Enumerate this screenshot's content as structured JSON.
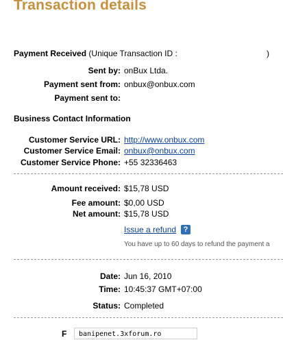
{
  "title": "Transaction details",
  "payment": {
    "label": "Payment Received",
    "id_prefix": "(Unique Transaction ID :",
    "id_suffix": ")"
  },
  "details": {
    "sent_by_label": "Sent by:",
    "sent_by_value": "onBux Ltda.",
    "sent_from_label": "Payment sent from:",
    "sent_from_value": "onbux@onbux.com",
    "sent_to_label": "Payment sent to:",
    "sent_to_value": ""
  },
  "business": {
    "heading": "Business Contact Information",
    "url_label": "Customer Service URL:",
    "url_value": "http://www.onbux.com",
    "email_label": "Customer Service Email:",
    "email_value": "onbux@onbux.com",
    "phone_label": "Customer Service Phone:",
    "phone_value": "+55 32336463"
  },
  "amounts": {
    "received_label": "Amount received:",
    "received_value": "$15,78 USD",
    "fee_label": "Fee amount:",
    "fee_value": "$0,00 USD",
    "net_label": "Net amount:",
    "net_value": "$15,78 USD",
    "refund_link": "Issue a refund",
    "help_icon": "?",
    "refund_note": "You have up to 60 days to refund the payment a"
  },
  "status_block": {
    "date_label": "Date:",
    "date_value": "Jun 16, 2010",
    "time_label": "Time:",
    "time_value": "10:45:37 GMT+07:00",
    "status_label": "Status:",
    "status_value": "Completed"
  },
  "footer": {
    "cut_glyph": "F",
    "watermark": "banipenet.3xforum.ro"
  },
  "colors": {
    "title": "#c8903b",
    "link": "#0b3f99",
    "help_icon": "#2f6fb8"
  }
}
